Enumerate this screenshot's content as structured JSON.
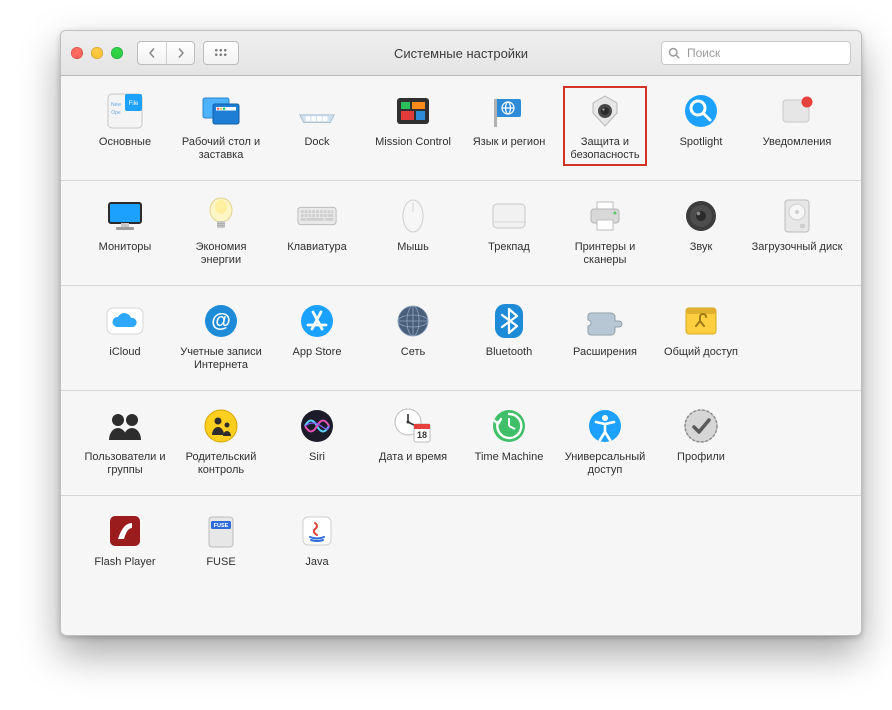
{
  "window": {
    "title": "Системные настройки"
  },
  "search": {
    "placeholder": "Поиск"
  },
  "highlighted": "security",
  "sections": [
    {
      "items": [
        {
          "id": "general",
          "label": "Основные"
        },
        {
          "id": "desktop",
          "label": "Рабочий стол и заставка"
        },
        {
          "id": "dock",
          "label": "Dock"
        },
        {
          "id": "mission",
          "label": "Mission Control"
        },
        {
          "id": "language",
          "label": "Язык и регион"
        },
        {
          "id": "security",
          "label": "Защита и безопасность"
        },
        {
          "id": "spotlight",
          "label": "Spotlight"
        },
        {
          "id": "notifications",
          "label": "Уведомления"
        }
      ]
    },
    {
      "items": [
        {
          "id": "displays",
          "label": "Мониторы"
        },
        {
          "id": "energy",
          "label": "Экономия энергии"
        },
        {
          "id": "keyboard",
          "label": "Клавиатура"
        },
        {
          "id": "mouse",
          "label": "Мышь"
        },
        {
          "id": "trackpad",
          "label": "Трекпад"
        },
        {
          "id": "printers",
          "label": "Принтеры и сканеры"
        },
        {
          "id": "sound",
          "label": "Звук"
        },
        {
          "id": "startup",
          "label": "Загрузочный диск"
        }
      ]
    },
    {
      "items": [
        {
          "id": "icloud",
          "label": "iCloud"
        },
        {
          "id": "accounts",
          "label": "Учетные записи Интернета"
        },
        {
          "id": "appstore",
          "label": "App Store"
        },
        {
          "id": "network",
          "label": "Сеть"
        },
        {
          "id": "bluetooth",
          "label": "Bluetooth"
        },
        {
          "id": "extensions",
          "label": "Расширения"
        },
        {
          "id": "sharing",
          "label": "Общий доступ"
        }
      ]
    },
    {
      "items": [
        {
          "id": "users",
          "label": "Пользователи и группы"
        },
        {
          "id": "parental",
          "label": "Родительский контроль"
        },
        {
          "id": "siri",
          "label": "Siri"
        },
        {
          "id": "datetime",
          "label": "Дата и время"
        },
        {
          "id": "timemachine",
          "label": "Time Machine"
        },
        {
          "id": "accessibility",
          "label": "Универсальный доступ"
        },
        {
          "id": "profiles",
          "label": "Профили"
        }
      ]
    },
    {
      "items": [
        {
          "id": "flash",
          "label": "Flash Player"
        },
        {
          "id": "fuse",
          "label": "FUSE"
        },
        {
          "id": "java",
          "label": "Java"
        }
      ]
    }
  ]
}
